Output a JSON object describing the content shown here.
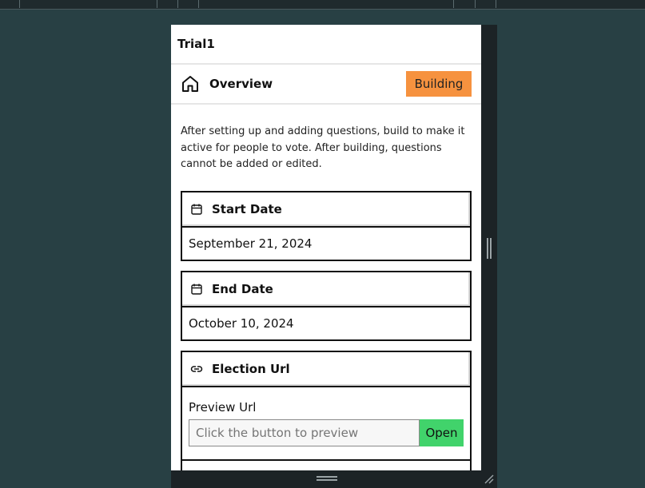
{
  "app": {
    "title": "Trial1"
  },
  "overview": {
    "title": "Overview",
    "status_badge": "Building"
  },
  "description": "After setting up and adding questions, build to make it active for people to vote. After building, questions cannot be added or edited.",
  "start_date": {
    "title": "Start Date",
    "value": "September 21, 2024",
    "icon": "calendar-icon"
  },
  "end_date": {
    "title": "End Date",
    "value": "October 10, 2024",
    "icon": "calendar-icon"
  },
  "election_url": {
    "title": "Election Url",
    "icon": "link-icon",
    "preview_label": "Preview Url",
    "preview_placeholder": "Click the button to preview",
    "open_label": "Open"
  },
  "colors": {
    "background": "#284044",
    "badge": "#f6923f",
    "open_button": "#41d36b"
  }
}
